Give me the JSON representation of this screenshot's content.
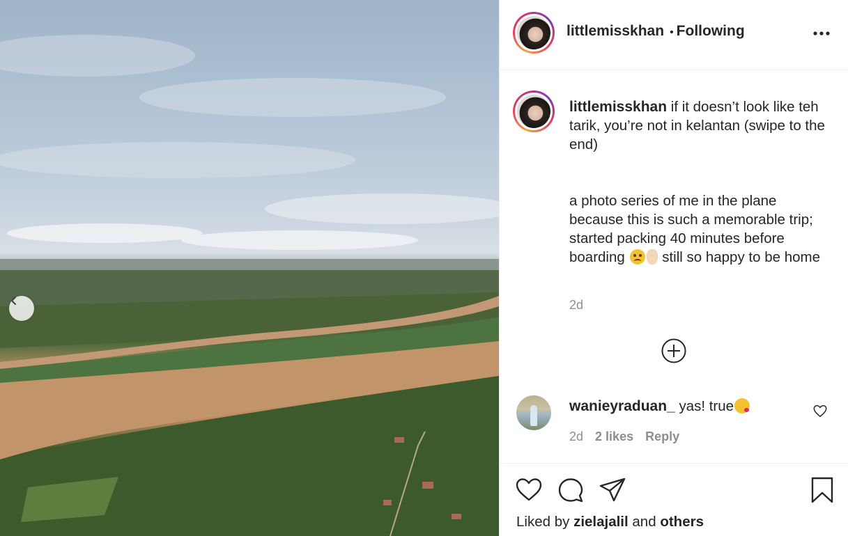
{
  "post": {
    "author": "littlemisskhan",
    "follow_separator": "•",
    "follow_status": "Following",
    "more_icon": "more-horizontal-icon",
    "caption": {
      "username": "littlemisskhan",
      "line1": "if it doesn’t look like teh tarik, you’re not in kelantan (swipe to the end)",
      "line2_before_emoji": "a photo series of me in the plane because this is such a memorable trip; started packing 40 minutes before boarding",
      "line2_after_emoji": "still so happy to be home"
    },
    "timestamp": "2d",
    "add_comment_icon": "plus-circle-icon"
  },
  "comments": [
    {
      "username": "wanieyraduan_",
      "text": "yas! true",
      "time": "2d",
      "likes": "2 likes",
      "reply_label": "Reply"
    }
  ],
  "footer": {
    "liked_by_prefix": "Liked by",
    "liked_by_user": "zielajalil",
    "liked_by_and": "and",
    "liked_by_others": "others"
  },
  "colors": {
    "text": "#262626",
    "secondary": "#8e8e8e",
    "divider": "#efefef",
    "ring_start": "#f9a03f",
    "ring_end": "#c13584"
  }
}
